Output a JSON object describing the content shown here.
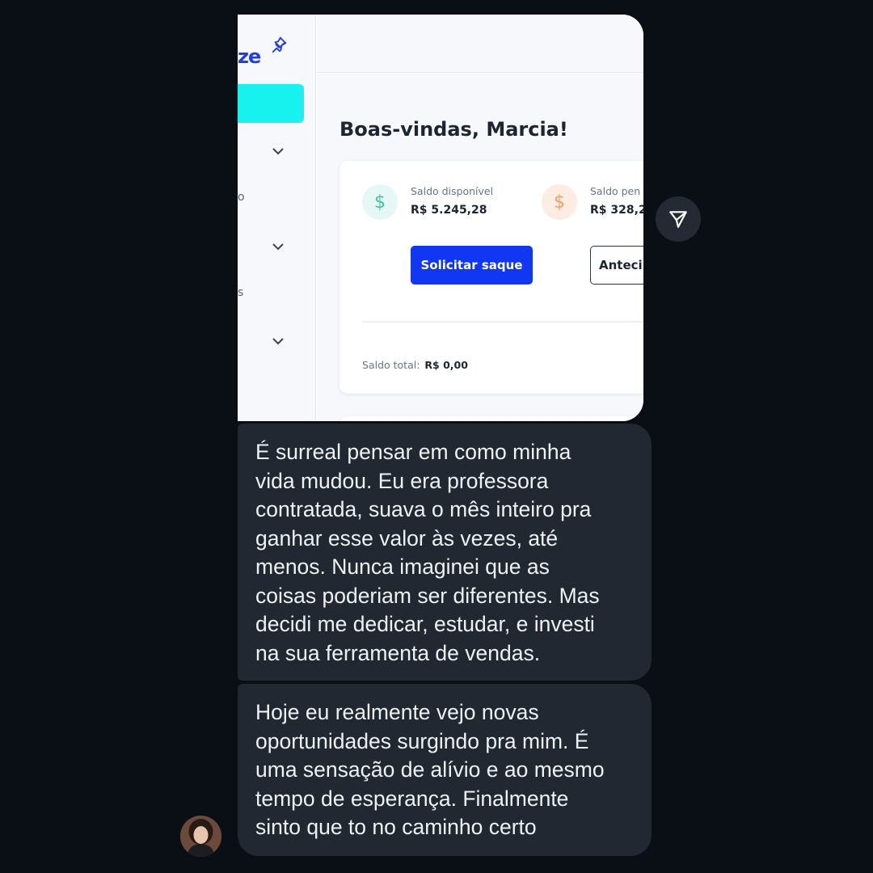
{
  "screenshot": {
    "logo_fragment": "ze",
    "nav_fragments": [
      "o",
      "s"
    ],
    "welcome": "Boas-vindas, Marcia!",
    "balances": [
      {
        "label": "Saldo disponível",
        "value": "R$ 5.245,28",
        "icon": "dollar-icon",
        "color": "#3cc7a6"
      },
      {
        "label": "Saldo pen",
        "value": "R$ 328,2",
        "icon": "dollar-icon",
        "color": "#f0a068"
      }
    ],
    "withdraw_button": "Solicitar saque",
    "advance_button": "Anteci",
    "total_label": "Saldo total:",
    "total_value": "R$ 0,00",
    "accent": "#18f2ee",
    "brand": "#1237f2"
  },
  "messages": [
    {
      "text": "É surreal pensar em como minha\nvida mudou. Eu era professora\ncontratada, suava o mês inteiro pra\nganhar esse valor às vezes, até\nmenos. Nunca imaginei que as\ncoisas poderiam ser diferentes. Mas\ndecidi me dedicar, estudar, e investi\nna sua ferramenta de vendas."
    },
    {
      "text": "Hoje eu realmente vejo novas\noportunidades surgindo pra mim. É\numa sensação de alívio e ao mesmo\ntempo de esperança. Finalmente\nsinto que to no caminho certo"
    }
  ],
  "icons": {
    "share": "share-icon",
    "pin": "pin-icon",
    "avatar": "avatar"
  }
}
